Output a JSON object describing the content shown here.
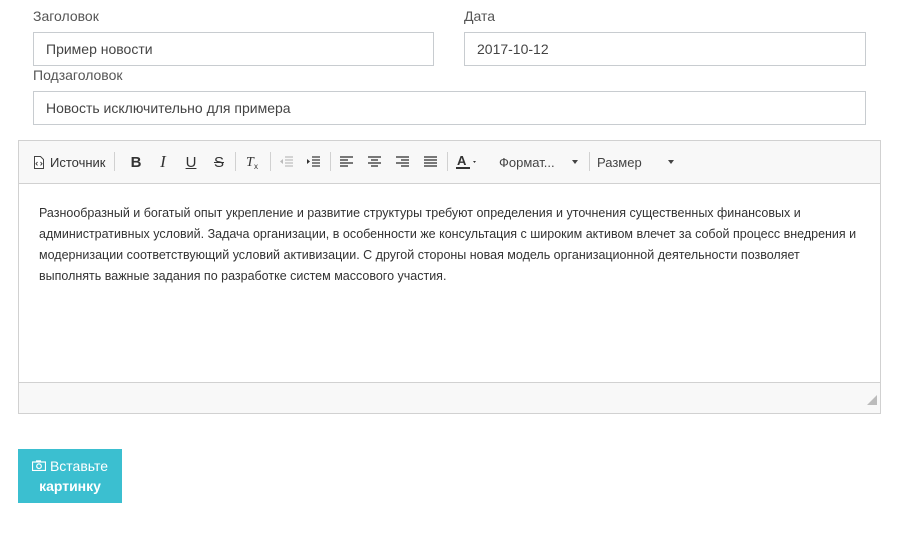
{
  "form": {
    "title_label": "Заголовок",
    "title_value": "Пример новости",
    "date_label": "Дата",
    "date_value": "2017-10-12",
    "subtitle_label": "Подзаголовок",
    "subtitle_value": "Новость исключительно для примера"
  },
  "editor": {
    "toolbar": {
      "source_label": "Источник",
      "format_label": "Формат...",
      "size_label": "Размер"
    },
    "content": "Разнообразный и богатый опыт укрепление и развитие структуры требуют определения и уточнения существенных финансовых и административных условий. Задача организации, в особенности же консультация с широким активом влечет за собой процесс внедрения и модернизации соответствующий условий активизации. С другой стороны новая модель организационной деятельности позволяет выполнять важные задания по разработке систем массового участия."
  },
  "image_button": {
    "line1": "Вставьте",
    "line2": "картинку",
    "icon": "camera-icon"
  },
  "colors": {
    "accent": "#3bbfd0",
    "toolbar_bg": "#f8f8f8",
    "border": "#c8ccd0"
  }
}
